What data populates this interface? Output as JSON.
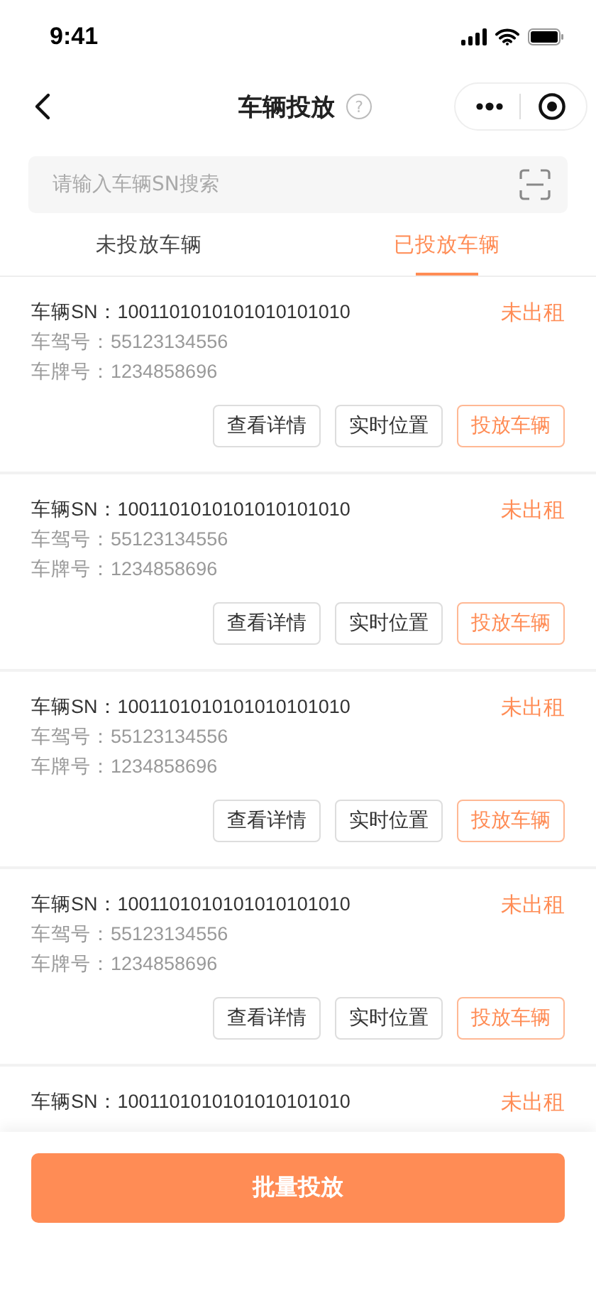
{
  "status_bar": {
    "time": "9:41"
  },
  "nav": {
    "title": "车辆投放",
    "help": "?"
  },
  "search": {
    "placeholder": "请输入车辆SN搜索"
  },
  "tabs": [
    {
      "label": "未投放车辆",
      "selected": false
    },
    {
      "label": "已投放车辆",
      "selected": true
    }
  ],
  "vehicles": [
    {
      "sn": "车辆SN：1001101010101010101010",
      "driver_no": "车驾号：55123134556",
      "plate_no": "车牌号：1234858696",
      "status": "未出租",
      "buttons": [
        {
          "label": "查看详情",
          "kind": "outline"
        },
        {
          "label": "实时位置",
          "kind": "outline"
        },
        {
          "label": "投放车辆",
          "kind": "accent"
        }
      ]
    },
    {
      "sn": "车辆SN：1001101010101010101010",
      "driver_no": "车驾号：55123134556",
      "plate_no": "车牌号：1234858696",
      "status": "未出租",
      "buttons": [
        {
          "label": "查看详情",
          "kind": "outline"
        },
        {
          "label": "实时位置",
          "kind": "outline"
        },
        {
          "label": "投放车辆",
          "kind": "accent"
        }
      ]
    },
    {
      "sn": "车辆SN：1001101010101010101010",
      "driver_no": "车驾号：55123134556",
      "plate_no": "车牌号：1234858696",
      "status": "未出租",
      "buttons": [
        {
          "label": "查看详情",
          "kind": "outline"
        },
        {
          "label": "实时位置",
          "kind": "outline"
        },
        {
          "label": "投放车辆",
          "kind": "accent"
        }
      ]
    },
    {
      "sn": "车辆SN：1001101010101010101010",
      "driver_no": "车驾号：55123134556",
      "plate_no": "车牌号：1234858696",
      "status": "未出租",
      "buttons": [
        {
          "label": "查看详情",
          "kind": "outline"
        },
        {
          "label": "实时位置",
          "kind": "outline"
        },
        {
          "label": "投放车辆",
          "kind": "accent"
        }
      ]
    },
    {
      "sn": "车辆SN：1001101010101010101010",
      "status": "未出租"
    }
  ],
  "bottom_button": "批量投放"
}
